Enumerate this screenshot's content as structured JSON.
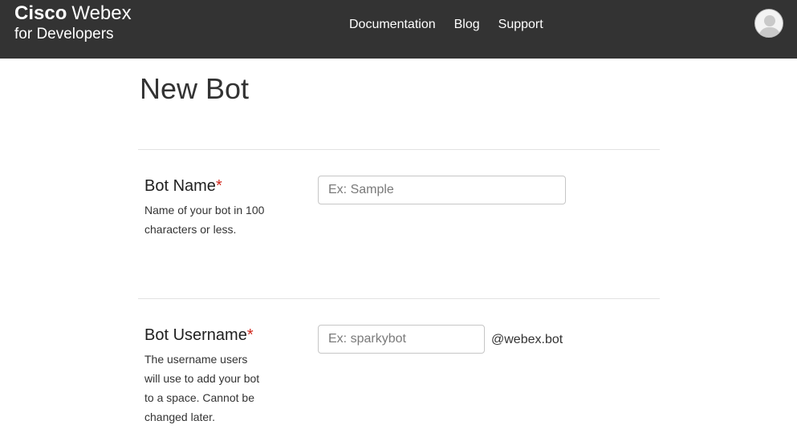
{
  "header": {
    "brand": {
      "cisco": "Cisco",
      "webex": "Webex",
      "subtitle": "for Developers"
    },
    "nav": [
      {
        "label": "Documentation"
      },
      {
        "label": "Blog"
      },
      {
        "label": "Support"
      }
    ],
    "avatar_icon": "user-avatar-icon",
    "background_color": "#333333"
  },
  "main": {
    "title": "New Bot",
    "fields": [
      {
        "label": "Bot Name",
        "required_marker": "*",
        "help": "Name of your bot in 100 characters or less.",
        "placeholder": "Ex: Sample",
        "value": ""
      },
      {
        "label": "Bot Username",
        "required_marker": "*",
        "help": "The username users will use to add your bot to a space. Cannot be changed later.",
        "placeholder": "Ex: sparkybot",
        "value": "",
        "suffix": "@webex.bot"
      }
    ],
    "required_color": "#d0271d"
  }
}
